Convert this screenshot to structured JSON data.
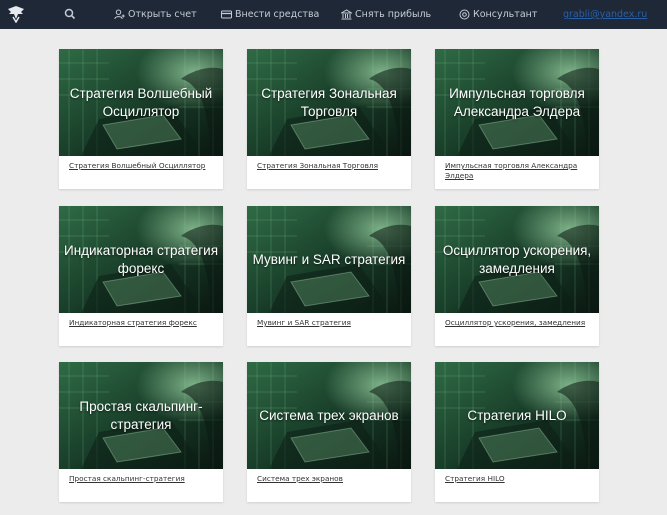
{
  "header": {
    "nav": [
      {
        "label": "Открыть счет",
        "icon": "user-add-icon"
      },
      {
        "label": "Внести средства",
        "icon": "card-icon"
      },
      {
        "label": "Снять прибыль",
        "icon": "bank-icon"
      },
      {
        "label": "Консультант",
        "icon": "help-icon"
      }
    ],
    "email": "grabli@yandex.ru"
  },
  "cards": [
    {
      "title": "Стратегия Волшебный Осциллятор",
      "link": "Стратегия Волшебный Осциллятор"
    },
    {
      "title": "Стратегия Зональная Торговля",
      "link": "Стратегия Зональная Торговля"
    },
    {
      "title": "Импульсная торговля Александра Элдера",
      "link": "Импульсная торговля Александра Элдера"
    },
    {
      "title": "Индикаторная стратегия форекс",
      "link": "Индикаторная стратегия форекс"
    },
    {
      "title": "Мувинг и SAR стратегия",
      "link": "Мувинг и SAR стратегия"
    },
    {
      "title": "Осциллятор ускорения, замедления",
      "link": "Осциллятор ускорения, замедления"
    },
    {
      "title": "Простая скальпинг-стратегия",
      "link": "Простая скальпинг-стратегия"
    },
    {
      "title": "Система трех экранов",
      "link": "Система трех экранов"
    },
    {
      "title": "Стратегия HILO",
      "link": "Стратегия HILO"
    }
  ]
}
